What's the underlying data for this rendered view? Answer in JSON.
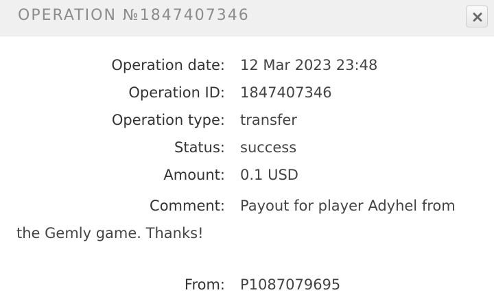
{
  "dialog": {
    "title": "OPERATION №1847407346"
  },
  "details": {
    "operation_date_label": "Operation date:",
    "operation_date_value": "12 Mar 2023 23:48",
    "operation_id_label": "Operation ID:",
    "operation_id_value": "1847407346",
    "operation_type_label": "Operation type:",
    "operation_type_value": "transfer",
    "status_label": "Status:",
    "status_value": "success",
    "amount_label": "Amount:",
    "amount_value": "0.1 USD",
    "comment_label": "Comment:",
    "comment_value": "Payout for player Adyhel from the Gemly game. Thanks!",
    "from_label": "From:",
    "from_value": "P1087079695"
  },
  "icons": {
    "close": "close-icon"
  }
}
